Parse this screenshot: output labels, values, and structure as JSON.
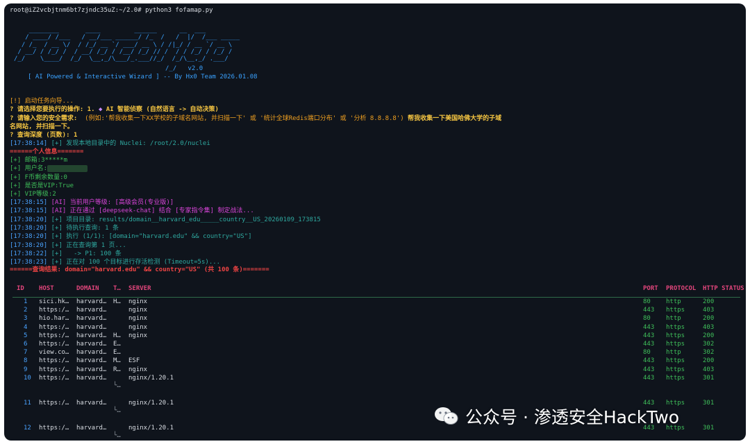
{
  "prompt": "root@iZ2vcbjtnm6bt7zjndc35uZ:~/2.0# python3 fofamap.py",
  "banner": {
    "art": "    ________       ____         ______      __  ___\n   / ____/ /___   / __/___ ______/ /_  /   /  |/  /___ _____\n  / /_  / __ \\/  / /_/ __ `/ ___/ __ \\ / /|_/ / __ `/ __ \\\n / __/ / /_/ /  / __/ /_/ / /__/ /_/ // /  / / /_/ / /_/ /\n/_/    \\____/  /_/  \\__,_/\\___/_.___//_/  /_/\\__,_/ .___/",
    "version": "/_/   v2.0",
    "subtitle": "[ AI Powered & Interactive Wizard ] -- By Hx0 Team 2026.01.08"
  },
  "wizard": {
    "start": "[!] 启动任务向导...",
    "q1_label": "? 请选择您要执行的操作: 1. ",
    "q1_icon": "magic-crystal-icon",
    "q1_answer": " AI 智能侦察 (自然语言 -> 自动决策)",
    "q2_label": "? 请输入您的安全需求:",
    "q2_example": "  (例如:'帮我收集一下XX学校的子域名网站, 并扫描一下' 或 '统计全球Redis端口分布' 或 '分析 8.8.8.8')",
    "q2_answer_a": " 帮我收集一下美国哈佛大学的子域",
    "q2_answer_b": "名网站, 并扫描一下。",
    "q3_label": "? 查询深度 (页数): ",
    "q3_answer": "1"
  },
  "log": {
    "nuclei_time": "[17:38:14]",
    "nuclei_msg": " [+] 发现本地目录中的 Nuclei: /root/2.0/nuclei",
    "info_header": "======个人信息=======",
    "email": "[+] 邮箱:3*****m",
    "username": "[+] 用户名:",
    "fcoin": "[+] F币剩余数量:0",
    "vip": "[+] 是否是VIP:True",
    "vip_level": "[+] VIP等级:2",
    "ai_lines": [
      {
        "time": "[17:38:15]",
        "msg": " [AI] 当前用户等级: [高级会员(专业版)]",
        "cls": "m"
      },
      {
        "time": "[17:38:15]",
        "msg": " [AI] 正在通过 [deepseek-chat] 结合 [专家指令集] 制定战法...",
        "cls": "m"
      },
      {
        "time": "[17:38:20]",
        "msg": " [+] 项目目录: results/domain__harvard_edu_____country__US_20260109_173815",
        "cls": "c"
      },
      {
        "time": "[17:38:20]",
        "msg": " [+] 待执行查询: 1 条",
        "cls": "c"
      },
      {
        "time": "[17:38:20]",
        "msg": " [+] 执行 (1/1): [domain=\"harvard.edu\" && country=\"US\"]",
        "cls": "c"
      },
      {
        "time": "[17:38:20]",
        "msg": " [+] 正在查询第 1 页...",
        "cls": "c"
      },
      {
        "time": "[17:38:22]",
        "msg": " [+]   -> P1: 100 条",
        "cls": "c"
      },
      {
        "time": "[17:38:23]",
        "msg": " [+] 正在对 100 个目标进行存活检测 (Timeout=5s)...",
        "cls": "c"
      }
    ],
    "result_header": "======查询结果: domain=\"harvard.edu\" && country=\"US\" (共 100 条)======="
  },
  "table": {
    "columns": [
      "ID",
      "HOST",
      "DOMAIN",
      "T…",
      "SERVER",
      "PORT",
      "PROTOCOL",
      "HTTP STATUS"
    ],
    "rows": [
      {
        "id": "1",
        "host": "sici.hk…",
        "domain": "harvard…",
        "title": "H…",
        "server": "nginx",
        "port": "80",
        "protocol": "http",
        "status": "200"
      },
      {
        "id": "2",
        "host": "https:/…",
        "domain": "harvard…",
        "title": "",
        "server": "nginx",
        "port": "443",
        "protocol": "https",
        "status": "403"
      },
      {
        "id": "3",
        "host": "hio.har…",
        "domain": "harvard…",
        "title": "",
        "server": "nginx",
        "port": "80",
        "protocol": "http",
        "status": "200"
      },
      {
        "id": "4",
        "host": "https:/…",
        "domain": "harvard…",
        "title": "",
        "server": "nginx",
        "port": "443",
        "protocol": "https",
        "status": "403"
      },
      {
        "id": "5",
        "host": "https:/…",
        "domain": "harvard…",
        "title": "H…",
        "server": "nginx",
        "port": "443",
        "protocol": "https",
        "status": "200"
      },
      {
        "id": "6",
        "host": "https:/…",
        "domain": "harvard…",
        "title": "E…",
        "server": "",
        "port": "443",
        "protocol": "https",
        "status": "302"
      },
      {
        "id": "7",
        "host": "view.co…",
        "domain": "harvard…",
        "title": "E…",
        "server": "",
        "port": "80",
        "protocol": "http",
        "status": "302"
      },
      {
        "id": "8",
        "host": "https:/…",
        "domain": "harvard…",
        "title": "M…",
        "server": "ESF",
        "port": "443",
        "protocol": "https",
        "status": "200"
      },
      {
        "id": "9",
        "host": "https:/…",
        "domain": "harvard…",
        "title": "R…",
        "server": "nginx",
        "port": "443",
        "protocol": "https",
        "status": "403"
      },
      {
        "id": "10",
        "host": "https:/…",
        "domain": "harvard…",
        "title": "",
        "server": "nginx/1.20.1",
        "port": "443",
        "protocol": "https",
        "status": "301"
      },
      {
        "id": "11",
        "host": "https:/…",
        "domain": "harvard…",
        "title": "",
        "server": "nginx/1.20.1",
        "port": "443",
        "protocol": "https",
        "status": "301"
      },
      {
        "id": "12",
        "host": "https:/…",
        "domain": "harvard…",
        "title": "",
        "server": "nginx/1.20.1",
        "port": "443",
        "protocol": "https",
        "status": "301"
      }
    ],
    "continuation": "└…"
  },
  "watermark": {
    "icon": "wechat-icon",
    "text": "公众号 · 渗透安全HackTwo"
  },
  "colors": {
    "background": "#0f141c",
    "banner": "#3aa2ff",
    "prompt": "#f5c542",
    "status": "#3fbf5a",
    "ai": "#d945d9",
    "header": "#e0457b"
  }
}
